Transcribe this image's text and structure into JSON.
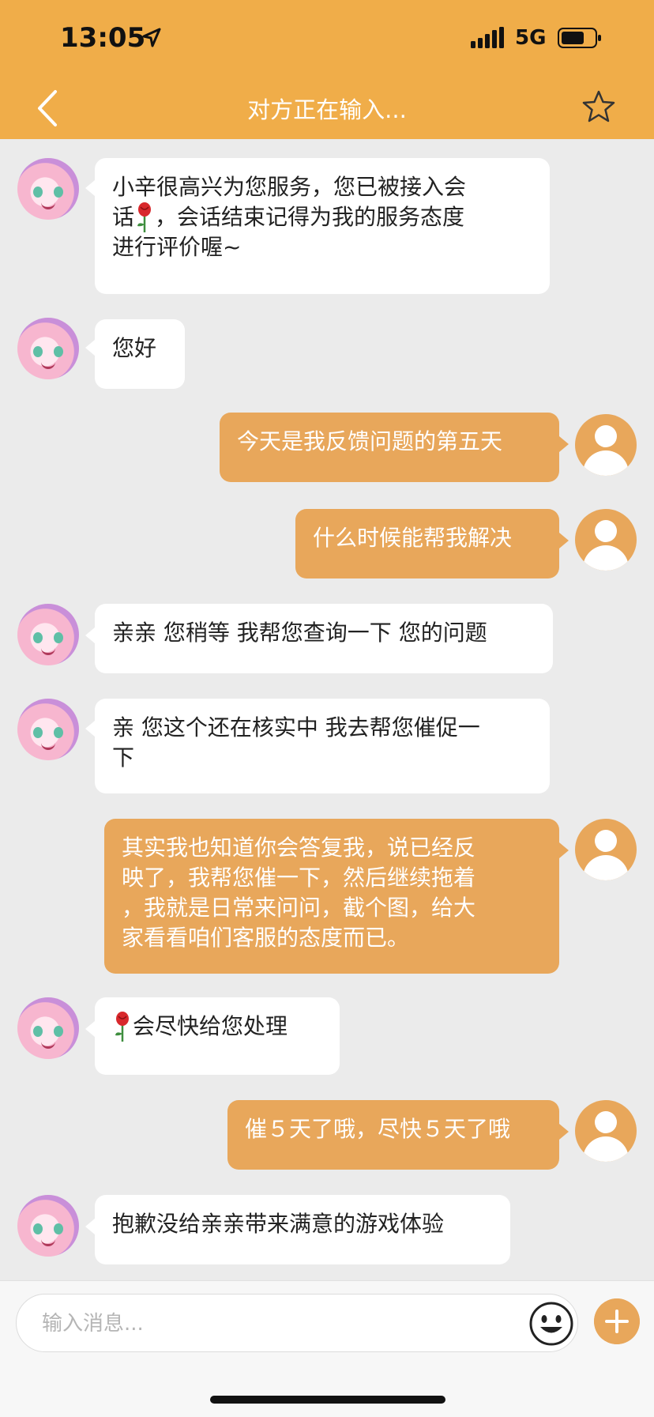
{
  "status": {
    "time": "13:05",
    "network": "5G"
  },
  "nav": {
    "title": "对方正在输入..."
  },
  "messages": [
    {
      "side": "left",
      "lines": [
        "小辛很高兴为您服务，您已被接入会",
        "话",
        "，会话结束记得为我的服务态度",
        "进行评价喔~"
      ]
    },
    {
      "side": "left",
      "text": "您好"
    },
    {
      "side": "right",
      "text": "今天是我反馈问题的第五天"
    },
    {
      "side": "right",
      "text": "什么时候能帮我解决"
    },
    {
      "side": "left",
      "text": "亲亲 您稍等 我帮您查询一下 您的问题"
    },
    {
      "side": "left",
      "lines": [
        "亲 您这个还在核实中  我去帮您催促一",
        "下"
      ]
    },
    {
      "side": "right",
      "lines": [
        "其实我也知道你会答复我，说已经反",
        "映了，我帮您催一下，然后继续拖着",
        "，我就是日常来问问，截个图，给大",
        "家看看咱们客服的态度而已。"
      ]
    },
    {
      "side": "left",
      "text": "会尽快给您处理"
    },
    {
      "side": "right",
      "text": "催５天了哦，尽快５天了哦"
    },
    {
      "side": "left",
      "text": "抱歉没给亲亲带来满意的游戏体验"
    }
  ],
  "composer": {
    "placeholder": "输入消息..."
  },
  "icons": {
    "back": "chevron-left-icon",
    "favorite": "star-icon",
    "emoji": "smiley-icon",
    "add": "plus-icon",
    "rose": "rose-icon"
  },
  "colors": {
    "accent": "#f0ad49",
    "bubble_right": "#e8a75b",
    "background": "#ebebeb"
  }
}
